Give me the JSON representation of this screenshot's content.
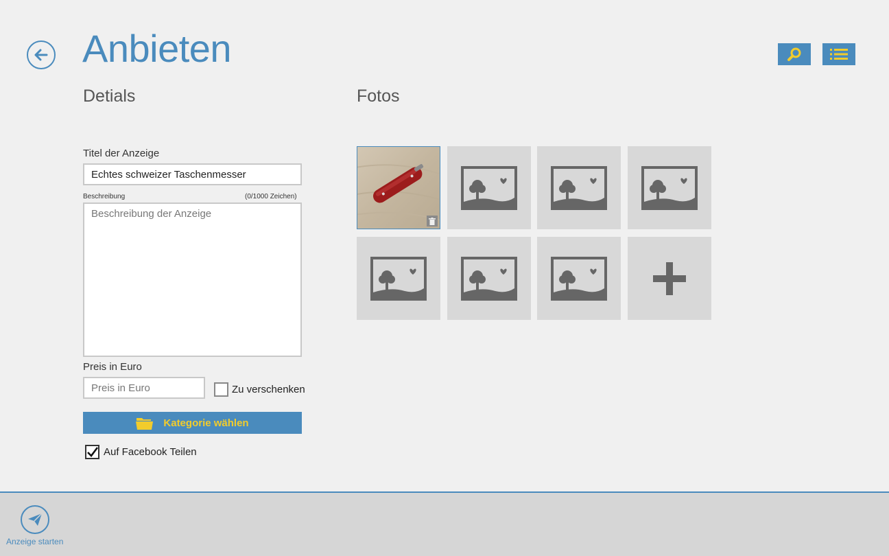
{
  "header": {
    "title": "Anbieten",
    "back_icon": "arrow-left-icon",
    "search_icon": "search-icon",
    "list_icon": "list-icon"
  },
  "details": {
    "heading": "Detials",
    "title_label": "Titel der Anzeige",
    "title_value": "Echtes schweizer Taschenmesser",
    "desc_label": "Beschreibung",
    "desc_counter": "(0/1000 Zeichen)",
    "desc_placeholder": "Beschreibung der Anzeige",
    "price_label": "Preis in Euro",
    "price_placeholder": "Preis in Euro",
    "giveaway_label": "Zu verschenken",
    "giveaway_checked": false,
    "category_button": "Kategorie wählen",
    "category_icon": "folder-icon",
    "facebook_label": "Auf Facebook Teilen",
    "facebook_checked": true
  },
  "fotos": {
    "heading": "Fotos",
    "slots": [
      "photo",
      "placeholder",
      "placeholder",
      "placeholder",
      "placeholder",
      "placeholder",
      "placeholder",
      "add"
    ]
  },
  "appbar": {
    "start_label": "Anzeige starten",
    "start_icon": "send-icon"
  },
  "colors": {
    "accent": "#4a8bbd",
    "highlight": "#f2cc2c",
    "background": "#f0f0f0"
  }
}
